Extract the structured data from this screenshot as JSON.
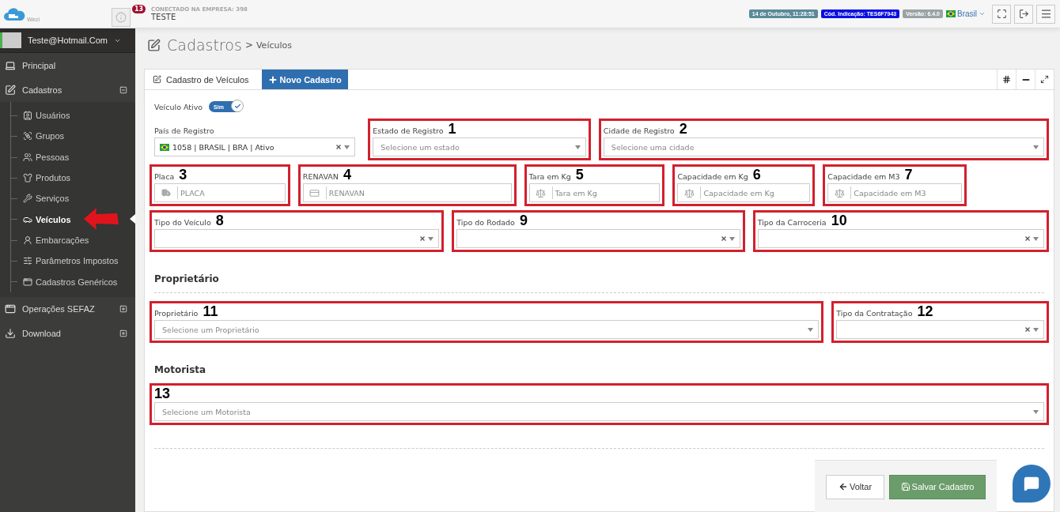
{
  "header": {
    "logo_text": "Wezi",
    "notification_count": "13",
    "company_label": "CONECTADO NA EMPRESA: 398",
    "company_name": "TESTE",
    "date": "14 de Outubro, 11:28:51",
    "referral": "Cód. Indicação: TES6F7943",
    "version": "Versão: 6.4.0",
    "language": "Brasil"
  },
  "sidebar": {
    "user": "Teste@Hotmail.Com",
    "items": [
      {
        "label": "Principal",
        "selected": false
      },
      {
        "label": "Cadastros",
        "selected": false,
        "expanded": true,
        "children": [
          {
            "label": "Usuários",
            "selected": false
          },
          {
            "label": "Grupos",
            "selected": false
          },
          {
            "label": "Pessoas",
            "selected": false
          },
          {
            "label": "Produtos",
            "selected": false
          },
          {
            "label": "Serviços",
            "selected": false
          },
          {
            "label": "Veículos",
            "selected": true
          },
          {
            "label": "Embarcações",
            "selected": false
          },
          {
            "label": "Parâmetros Impostos",
            "selected": false
          },
          {
            "label": "Cadastros Genéricos",
            "selected": false
          }
        ]
      },
      {
        "label": "Operações SEFAZ",
        "selected": false,
        "expanded": false
      },
      {
        "label": "Download",
        "selected": false,
        "expanded": false
      }
    ]
  },
  "breadcrumb": {
    "title": "Cadastros",
    "separator": ">",
    "current": "Veículos"
  },
  "panel": {
    "tabs": [
      {
        "label": "Cadastro de Veículos",
        "selected": true
      }
    ],
    "new_button": "Novo Cadastro"
  },
  "active_toggle": {
    "label": "Veículo Ativo",
    "text": "Sim",
    "on": true
  },
  "sections": [
    {
      "rows": [
        [
          {
            "label": "País de Registro",
            "kind": "select",
            "value": "1058 | BRASIL | BRA | Ativo",
            "clearable": true
          },
          {
            "label": "Estado de Registro",
            "kind": "select",
            "placeholder": "Selecione um estado",
            "clearable": false,
            "annotation": "1"
          },
          {
            "label": "Cidade de Registro",
            "kind": "select",
            "placeholder": "Selecione uma cidade",
            "clearable": false,
            "annotation": "2"
          }
        ],
        [
          {
            "label": "Placa",
            "kind": "input",
            "placeholder": "PLACA",
            "annotation": "3"
          },
          {
            "label": "RENAVAN",
            "kind": "input",
            "placeholder": "RENAVAN",
            "annotation": "4"
          },
          {
            "label": "Tara em Kg",
            "kind": "input",
            "placeholder": "Tara em Kg",
            "annotation": "5"
          },
          {
            "label": "Capacidade em Kg",
            "kind": "input",
            "placeholder": "Capacidade em Kg",
            "annotation": "6"
          },
          {
            "label": "Capacidade em M3",
            "kind": "input",
            "placeholder": "Capacidade em M3",
            "annotation": "7"
          }
        ],
        [
          {
            "label": "Tipo do Veículo",
            "kind": "select",
            "clearable": true,
            "annotation": "8"
          },
          {
            "label": "Tipo do Rodado",
            "kind": "select",
            "clearable": true,
            "annotation": "9"
          },
          {
            "label": "Tipo da Carroceria",
            "kind": "select",
            "clearable": true,
            "annotation": "10"
          }
        ]
      ]
    },
    {
      "title": "Proprietário",
      "rows": [
        [
          {
            "label": "Proprietário",
            "kind": "select",
            "placeholder": "Selecione um Proprietário",
            "clearable": false,
            "annotation": "11"
          },
          {
            "label": "Tipo da Contratação",
            "kind": "select",
            "clearable": true,
            "annotation": "12"
          }
        ]
      ]
    },
    {
      "title": "Motorista",
      "rows": [
        [
          {
            "kind": "select",
            "placeholder": "Selecione um Motorista",
            "clearable": false,
            "annotation": "13"
          }
        ]
      ]
    }
  ],
  "buttons": {
    "back": "Voltar",
    "save": "Salvar Cadastro"
  }
}
